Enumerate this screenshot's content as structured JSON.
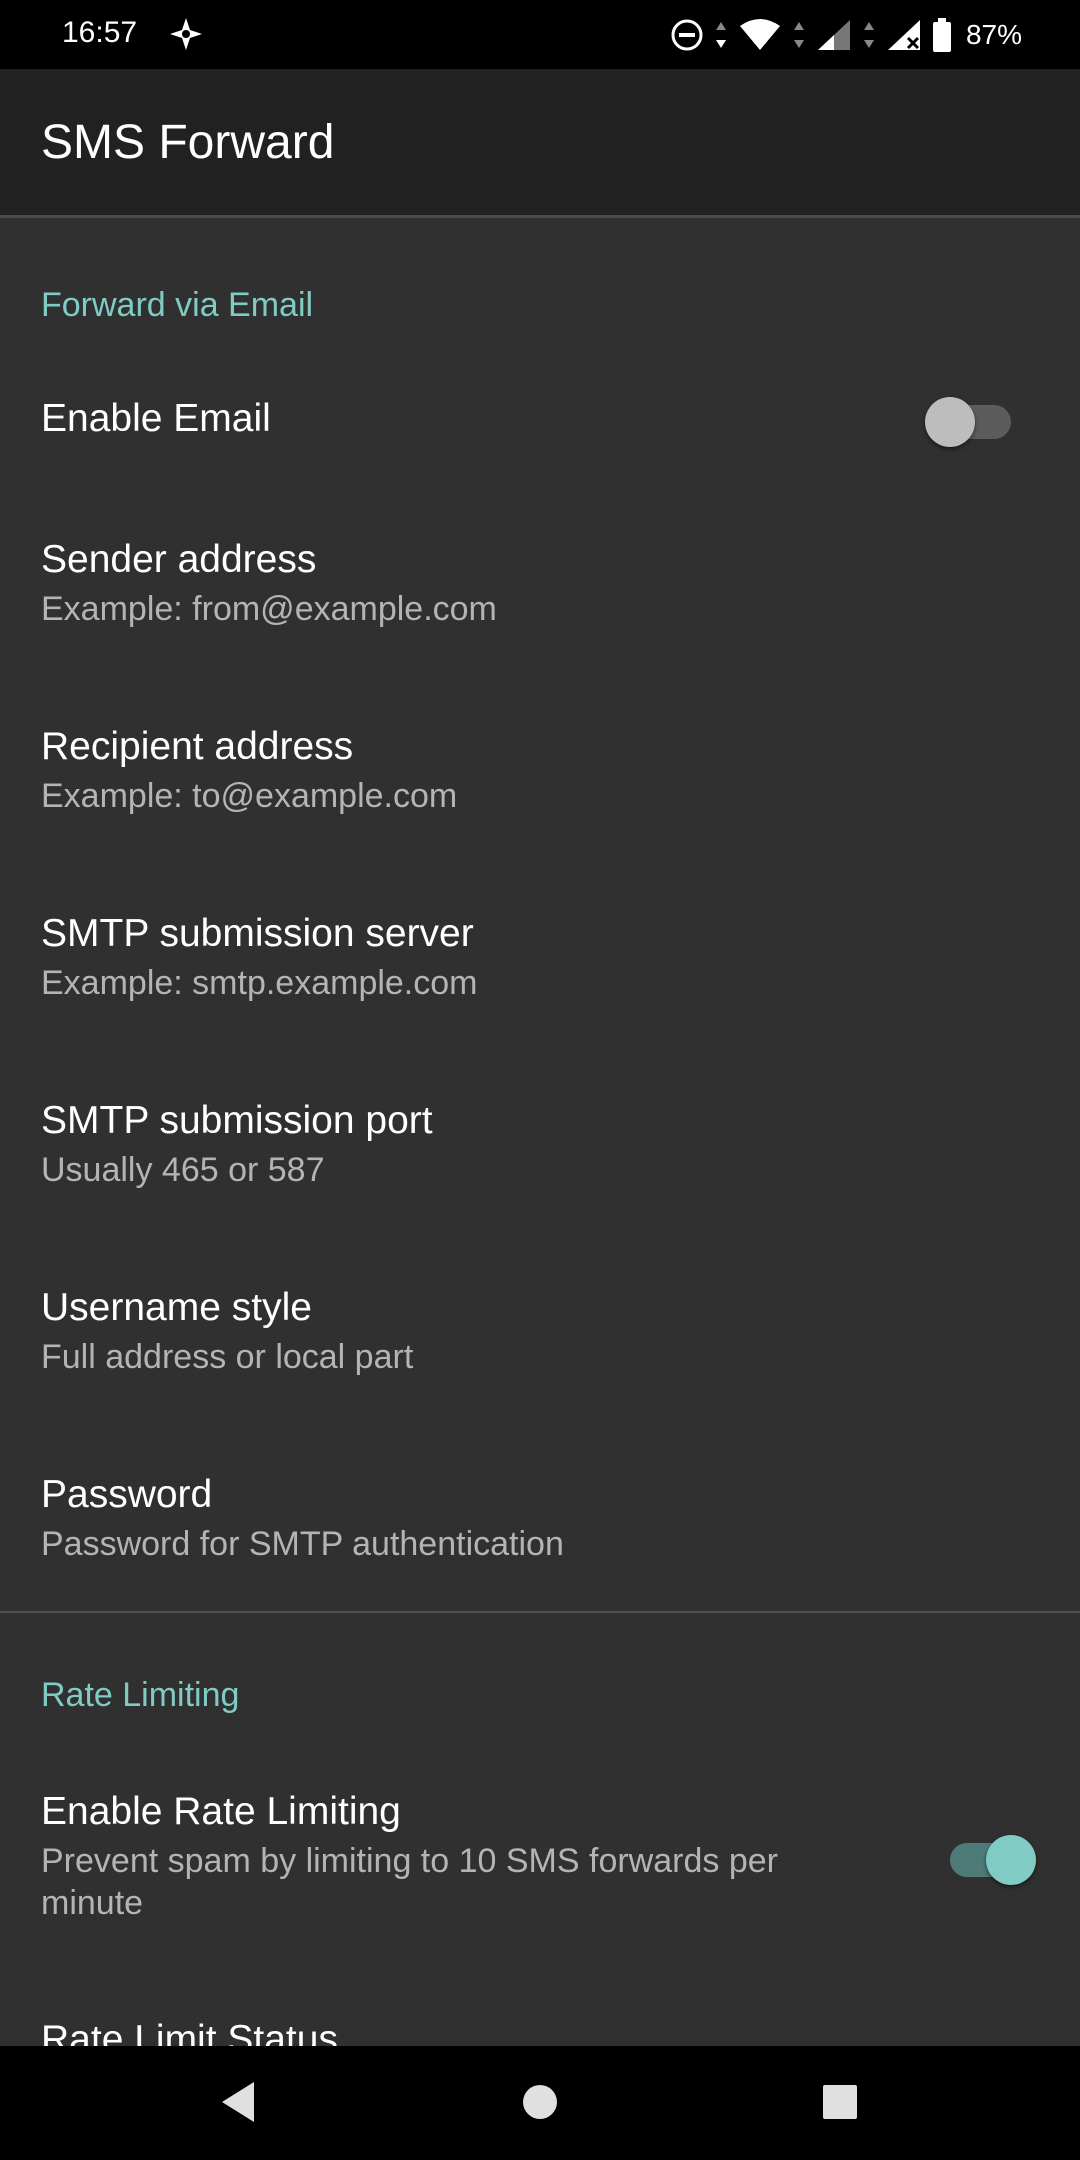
{
  "status_bar": {
    "time": "16:57",
    "battery_percent": "87%",
    "icons": [
      "navigation-icon",
      "dnd-icon",
      "wifi-icon",
      "signal-icon",
      "signal-no-data-icon",
      "battery-icon"
    ]
  },
  "app_bar": {
    "title": "SMS Forward"
  },
  "sections": {
    "email": {
      "title": "Forward via Email",
      "enable_email": {
        "title": "Enable Email",
        "checked": false
      },
      "sender": {
        "title": "Sender address",
        "summary": "Example: from@example.com"
      },
      "recipient": {
        "title": "Recipient address",
        "summary": "Example: to@example.com"
      },
      "smtp_server": {
        "title": "SMTP submission server",
        "summary": "Example: smtp.example.com"
      },
      "smtp_port": {
        "title": "SMTP submission port",
        "summary": "Usually 465 or 587"
      },
      "username_style": {
        "title": "Username style",
        "summary": "Full address or local part"
      },
      "password": {
        "title": "Password",
        "summary": "Password for SMTP authentication"
      }
    },
    "rate": {
      "title": "Rate Limiting",
      "enable_rate": {
        "title": "Enable Rate Limiting",
        "summary": "Prevent spam by limiting to 10 SMS forwards per minute",
        "checked": true
      },
      "status": {
        "title": "Rate Limit Status"
      }
    }
  },
  "colors": {
    "accent": "#80cbc4",
    "background": "#303030",
    "app_bar": "#212121",
    "summary_text": "#b4b4b4"
  },
  "nav_bar": {
    "icons": [
      "back-icon",
      "home-icon",
      "recents-icon"
    ]
  }
}
